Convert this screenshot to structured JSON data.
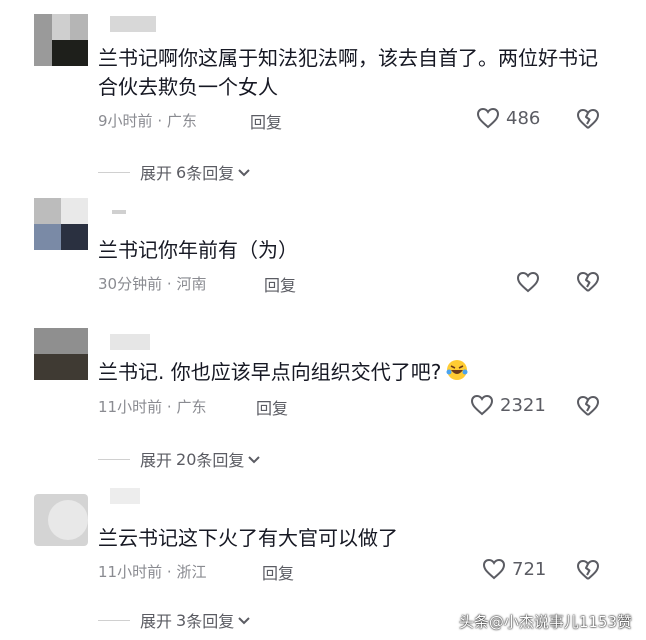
{
  "comments": [
    {
      "text": "兰书记啊你这属于知法犯法啊，该去自首了。两位好书记合伙去欺负一个女人",
      "time": "9小时前",
      "location": "广东",
      "reply_label": "回复",
      "likes": "486",
      "expand_label": "展开",
      "expand_count": "6",
      "expand_suffix": "条回复"
    },
    {
      "text": "兰书记你年前有（为）",
      "time": "30分钟前",
      "location": "河南",
      "reply_label": "回复",
      "likes": ""
    },
    {
      "text": "兰书记. 你也应该早点向组织交代了吧?",
      "time": "11小时前",
      "location": "广东",
      "reply_label": "回复",
      "likes": "2321",
      "expand_label": "展开",
      "expand_count": "20",
      "expand_suffix": "条回复"
    },
    {
      "text": "兰云书记这下火了有大官可以做了",
      "time": "11小时前",
      "location": "浙江",
      "reply_label": "回复",
      "likes": "721",
      "expand_label": "展开",
      "expand_count": "3",
      "expand_suffix": "条回复"
    }
  ],
  "separator": "·",
  "watermark": "头条@小杰说事儿1153赞",
  "colors": {
    "text": "#161823",
    "meta": "#8a8b91",
    "action": "#5b5c63"
  },
  "icons": {
    "like": "heart-outline-icon",
    "dislike": "broken-heart-icon",
    "expand": "chevron-down-icon",
    "emoji": "laughing-tears-emoji"
  }
}
